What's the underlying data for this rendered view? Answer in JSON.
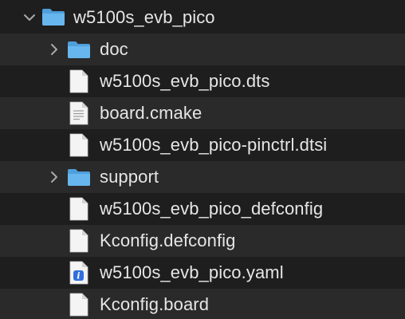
{
  "tree": {
    "root": {
      "name": "w5100s_evb_pico",
      "expanded": true,
      "icon": "folder-icon"
    },
    "items": [
      {
        "name": "doc",
        "kind": "folder",
        "icon": "folder-icon",
        "expanded": false
      },
      {
        "name": "w5100s_evb_pico.dts",
        "kind": "file",
        "icon": "blank-document-icon"
      },
      {
        "name": "board.cmake",
        "kind": "file",
        "icon": "text-document-icon"
      },
      {
        "name": "w5100s_evb_pico-pinctrl.dtsi",
        "kind": "file",
        "icon": "blank-document-icon"
      },
      {
        "name": "support",
        "kind": "folder",
        "icon": "folder-icon",
        "expanded": false
      },
      {
        "name": "w5100s_evb_pico_defconfig",
        "kind": "file",
        "icon": "blank-document-icon"
      },
      {
        "name": "Kconfig.defconfig",
        "kind": "file",
        "icon": "blank-document-icon"
      },
      {
        "name": "w5100s_evb_pico.yaml",
        "kind": "file",
        "icon": "yaml-document-icon"
      },
      {
        "name": "Kconfig.board",
        "kind": "file",
        "icon": "blank-document-icon"
      }
    ]
  },
  "colors": {
    "background": "#1e1e1e",
    "alt_row": "#2a2a2a",
    "folder": "#5aaee8",
    "text": "#e6e6e6",
    "chevron": "#a8a8a8"
  }
}
